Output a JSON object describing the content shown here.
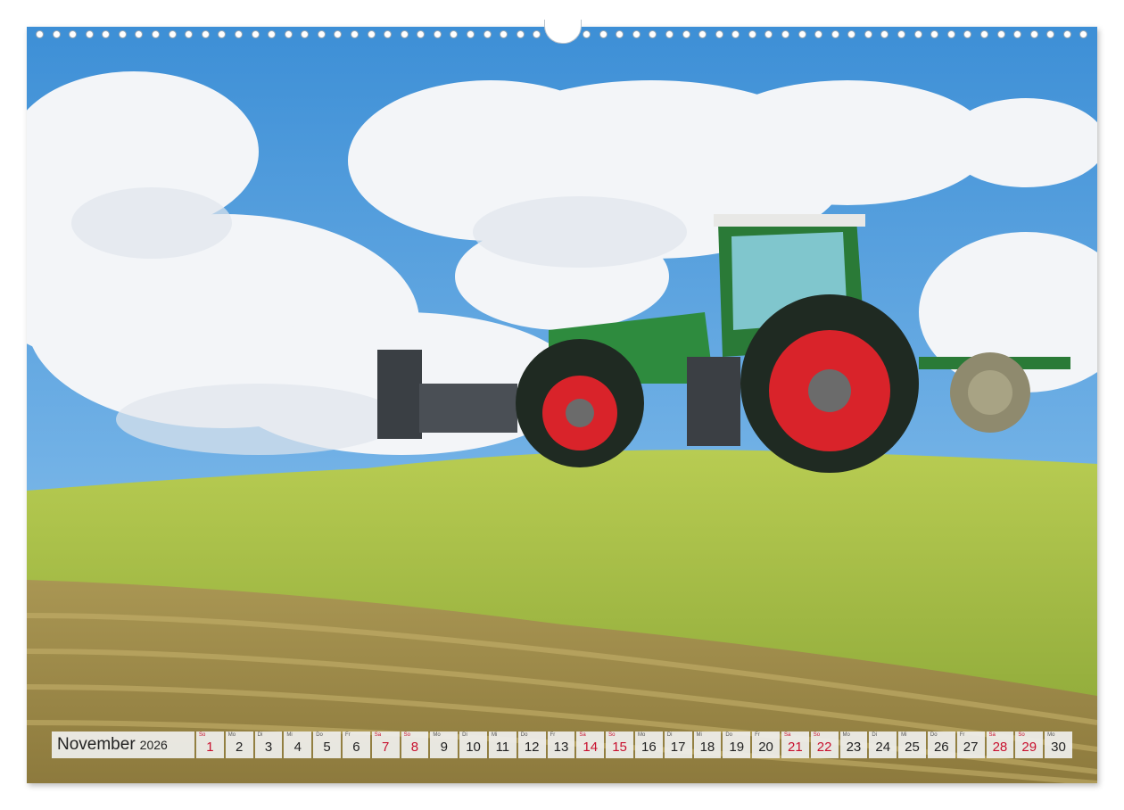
{
  "calendar": {
    "month": "November",
    "year": "2026",
    "days": [
      {
        "num": "1",
        "wd": "So",
        "weekend": true
      },
      {
        "num": "2",
        "wd": "Mo",
        "weekend": false
      },
      {
        "num": "3",
        "wd": "Di",
        "weekend": false
      },
      {
        "num": "4",
        "wd": "Mi",
        "weekend": false
      },
      {
        "num": "5",
        "wd": "Do",
        "weekend": false
      },
      {
        "num": "6",
        "wd": "Fr",
        "weekend": false
      },
      {
        "num": "7",
        "wd": "Sa",
        "weekend": true
      },
      {
        "num": "8",
        "wd": "So",
        "weekend": true
      },
      {
        "num": "9",
        "wd": "Mo",
        "weekend": false
      },
      {
        "num": "10",
        "wd": "Di",
        "weekend": false
      },
      {
        "num": "11",
        "wd": "Mi",
        "weekend": false
      },
      {
        "num": "12",
        "wd": "Do",
        "weekend": false
      },
      {
        "num": "13",
        "wd": "Fr",
        "weekend": false
      },
      {
        "num": "14",
        "wd": "Sa",
        "weekend": true
      },
      {
        "num": "15",
        "wd": "So",
        "weekend": true
      },
      {
        "num": "16",
        "wd": "Mo",
        "weekend": false
      },
      {
        "num": "17",
        "wd": "Di",
        "weekend": false
      },
      {
        "num": "18",
        "wd": "Mi",
        "weekend": false
      },
      {
        "num": "19",
        "wd": "Do",
        "weekend": false
      },
      {
        "num": "20",
        "wd": "Fr",
        "weekend": false
      },
      {
        "num": "21",
        "wd": "Sa",
        "weekend": true
      },
      {
        "num": "22",
        "wd": "So",
        "weekend": true
      },
      {
        "num": "23",
        "wd": "Mo",
        "weekend": false
      },
      {
        "num": "24",
        "wd": "Di",
        "weekend": false
      },
      {
        "num": "25",
        "wd": "Mi",
        "weekend": false
      },
      {
        "num": "26",
        "wd": "Do",
        "weekend": false
      },
      {
        "num": "27",
        "wd": "Fr",
        "weekend": false
      },
      {
        "num": "28",
        "wd": "Sa",
        "weekend": true
      },
      {
        "num": "29",
        "wd": "So",
        "weekend": true
      },
      {
        "num": "30",
        "wd": "Mo",
        "weekend": false
      }
    ]
  },
  "photo": {
    "subject": "green-tractor-on-silage-hill",
    "colors": {
      "sky": "#4a9ee0",
      "cloud": "#f4f6f9",
      "hill": "#a8c04a",
      "field": "#b49a55",
      "tractor": "#2e8b3e",
      "rim": "#d9232a"
    }
  }
}
